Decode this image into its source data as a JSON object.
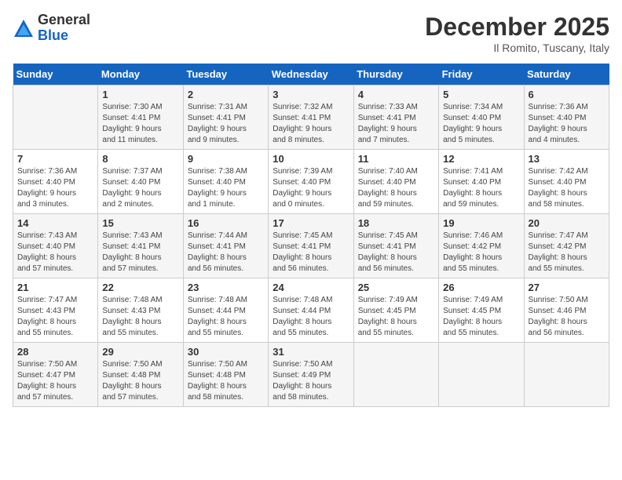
{
  "header": {
    "logo": {
      "general": "General",
      "blue": "Blue"
    },
    "title": "December 2025",
    "subtitle": "Il Romito, Tuscany, Italy"
  },
  "days_of_week": [
    "Sunday",
    "Monday",
    "Tuesday",
    "Wednesday",
    "Thursday",
    "Friday",
    "Saturday"
  ],
  "weeks": [
    [
      {
        "day": "",
        "details": ""
      },
      {
        "day": "1",
        "details": "Sunrise: 7:30 AM\nSunset: 4:41 PM\nDaylight: 9 hours\nand 11 minutes."
      },
      {
        "day": "2",
        "details": "Sunrise: 7:31 AM\nSunset: 4:41 PM\nDaylight: 9 hours\nand 9 minutes."
      },
      {
        "day": "3",
        "details": "Sunrise: 7:32 AM\nSunset: 4:41 PM\nDaylight: 9 hours\nand 8 minutes."
      },
      {
        "day": "4",
        "details": "Sunrise: 7:33 AM\nSunset: 4:41 PM\nDaylight: 9 hours\nand 7 minutes."
      },
      {
        "day": "5",
        "details": "Sunrise: 7:34 AM\nSunset: 4:40 PM\nDaylight: 9 hours\nand 5 minutes."
      },
      {
        "day": "6",
        "details": "Sunrise: 7:36 AM\nSunset: 4:40 PM\nDaylight: 9 hours\nand 4 minutes."
      }
    ],
    [
      {
        "day": "7",
        "details": "Sunrise: 7:36 AM\nSunset: 4:40 PM\nDaylight: 9 hours\nand 3 minutes."
      },
      {
        "day": "8",
        "details": "Sunrise: 7:37 AM\nSunset: 4:40 PM\nDaylight: 9 hours\nand 2 minutes."
      },
      {
        "day": "9",
        "details": "Sunrise: 7:38 AM\nSunset: 4:40 PM\nDaylight: 9 hours\nand 1 minute."
      },
      {
        "day": "10",
        "details": "Sunrise: 7:39 AM\nSunset: 4:40 PM\nDaylight: 9 hours\nand 0 minutes."
      },
      {
        "day": "11",
        "details": "Sunrise: 7:40 AM\nSunset: 4:40 PM\nDaylight: 8 hours\nand 59 minutes."
      },
      {
        "day": "12",
        "details": "Sunrise: 7:41 AM\nSunset: 4:40 PM\nDaylight: 8 hours\nand 59 minutes."
      },
      {
        "day": "13",
        "details": "Sunrise: 7:42 AM\nSunset: 4:40 PM\nDaylight: 8 hours\nand 58 minutes."
      }
    ],
    [
      {
        "day": "14",
        "details": "Sunrise: 7:43 AM\nSunset: 4:40 PM\nDaylight: 8 hours\nand 57 minutes."
      },
      {
        "day": "15",
        "details": "Sunrise: 7:43 AM\nSunset: 4:41 PM\nDaylight: 8 hours\nand 57 minutes."
      },
      {
        "day": "16",
        "details": "Sunrise: 7:44 AM\nSunset: 4:41 PM\nDaylight: 8 hours\nand 56 minutes."
      },
      {
        "day": "17",
        "details": "Sunrise: 7:45 AM\nSunset: 4:41 PM\nDaylight: 8 hours\nand 56 minutes."
      },
      {
        "day": "18",
        "details": "Sunrise: 7:45 AM\nSunset: 4:41 PM\nDaylight: 8 hours\nand 56 minutes."
      },
      {
        "day": "19",
        "details": "Sunrise: 7:46 AM\nSunset: 4:42 PM\nDaylight: 8 hours\nand 55 minutes."
      },
      {
        "day": "20",
        "details": "Sunrise: 7:47 AM\nSunset: 4:42 PM\nDaylight: 8 hours\nand 55 minutes."
      }
    ],
    [
      {
        "day": "21",
        "details": "Sunrise: 7:47 AM\nSunset: 4:43 PM\nDaylight: 8 hours\nand 55 minutes."
      },
      {
        "day": "22",
        "details": "Sunrise: 7:48 AM\nSunset: 4:43 PM\nDaylight: 8 hours\nand 55 minutes."
      },
      {
        "day": "23",
        "details": "Sunrise: 7:48 AM\nSunset: 4:44 PM\nDaylight: 8 hours\nand 55 minutes."
      },
      {
        "day": "24",
        "details": "Sunrise: 7:48 AM\nSunset: 4:44 PM\nDaylight: 8 hours\nand 55 minutes."
      },
      {
        "day": "25",
        "details": "Sunrise: 7:49 AM\nSunset: 4:45 PM\nDaylight: 8 hours\nand 55 minutes."
      },
      {
        "day": "26",
        "details": "Sunrise: 7:49 AM\nSunset: 4:45 PM\nDaylight: 8 hours\nand 55 minutes."
      },
      {
        "day": "27",
        "details": "Sunrise: 7:50 AM\nSunset: 4:46 PM\nDaylight: 8 hours\nand 56 minutes."
      }
    ],
    [
      {
        "day": "28",
        "details": "Sunrise: 7:50 AM\nSunset: 4:47 PM\nDaylight: 8 hours\nand 57 minutes."
      },
      {
        "day": "29",
        "details": "Sunrise: 7:50 AM\nSunset: 4:48 PM\nDaylight: 8 hours\nand 57 minutes."
      },
      {
        "day": "30",
        "details": "Sunrise: 7:50 AM\nSunset: 4:48 PM\nDaylight: 8 hours\nand 58 minutes."
      },
      {
        "day": "31",
        "details": "Sunrise: 7:50 AM\nSunset: 4:49 PM\nDaylight: 8 hours\nand 58 minutes."
      },
      {
        "day": "",
        "details": ""
      },
      {
        "day": "",
        "details": ""
      },
      {
        "day": "",
        "details": ""
      }
    ]
  ]
}
